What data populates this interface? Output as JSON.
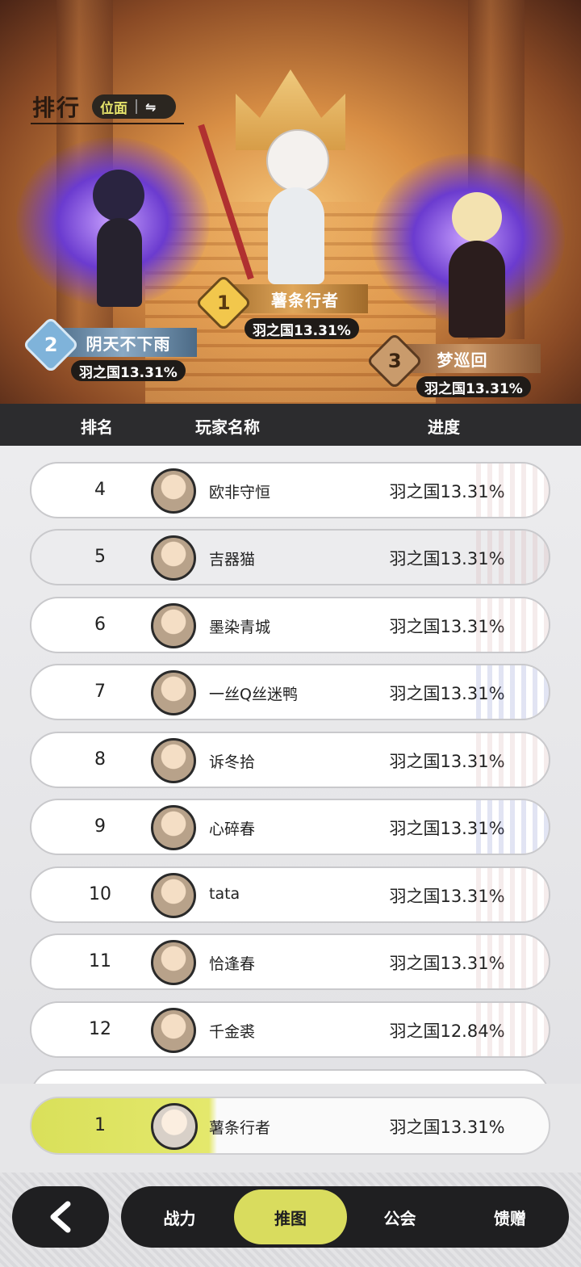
{
  "header": {
    "title": "排行",
    "switch_label": "位面",
    "switch_icon": "swap-arrows-icon"
  },
  "podium": [
    {
      "rank": "1",
      "name": "薯条行者",
      "progress": "羽之国13.31%"
    },
    {
      "rank": "2",
      "name": "阴天不下雨",
      "progress": "羽之国13.31%"
    },
    {
      "rank": "3",
      "name": "梦巡回",
      "progress": "羽之国13.31%"
    }
  ],
  "columns": {
    "rank": "排名",
    "player": "玩家名称",
    "progress": "进度"
  },
  "rows": [
    {
      "rank": "4",
      "name": "欧非守恒",
      "progress": "羽之国13.31%"
    },
    {
      "rank": "5",
      "name": "吉器猫",
      "progress": "羽之国13.31%"
    },
    {
      "rank": "6",
      "name": "墨染青城",
      "progress": "羽之国13.31%"
    },
    {
      "rank": "7",
      "name": "一丝Q丝迷鸭",
      "progress": "羽之国13.31%"
    },
    {
      "rank": "8",
      "name": "诉冬拾",
      "progress": "羽之国13.31%"
    },
    {
      "rank": "9",
      "name": "心碎春",
      "progress": "羽之国13.31%"
    },
    {
      "rank": "10",
      "name": "tata",
      "progress": "羽之国13.31%"
    },
    {
      "rank": "11",
      "name": "恰逢春",
      "progress": "羽之国13.31%"
    },
    {
      "rank": "12",
      "name": "千金裘",
      "progress": "羽之国12.84%"
    }
  ],
  "self": {
    "rank": "1",
    "name": "薯条行者",
    "progress": "羽之国13.31%"
  },
  "nav": {
    "back_icon": "back-arrow-icon",
    "tabs": [
      {
        "label": "战力"
      },
      {
        "label": "推图"
      },
      {
        "label": "公会"
      },
      {
        "label": "馈赠"
      }
    ],
    "active_tab": "推图"
  },
  "colors": {
    "accent": "#d9dc5e",
    "dark": "#1f1f21"
  }
}
